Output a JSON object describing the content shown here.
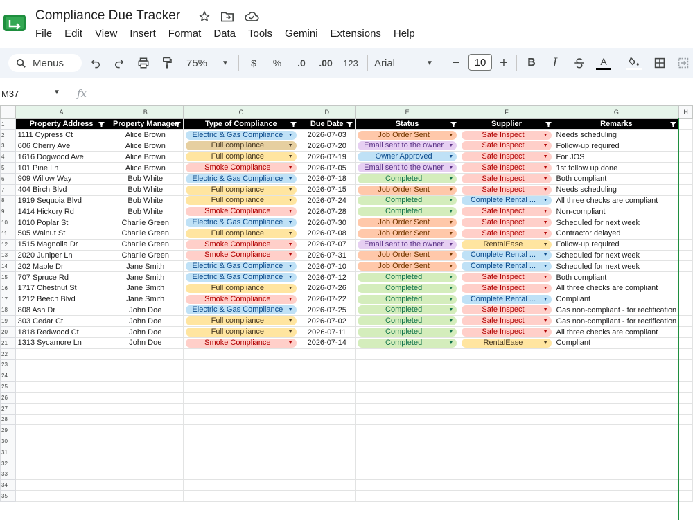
{
  "app": {
    "title": "Compliance Due Tracker",
    "menus": [
      "File",
      "Edit",
      "View",
      "Insert",
      "Format",
      "Data",
      "Tools",
      "Gemini",
      "Extensions",
      "Help"
    ]
  },
  "toolbar": {
    "search_label": "Menus",
    "zoom": "75%",
    "currency": "$",
    "percent": "%",
    "decrease_decimal": ".0",
    "increase_decimal": ".00",
    "number_format": "123",
    "font": "Arial",
    "font_size": "10",
    "bold": "B",
    "italic": "I",
    "text_color_letter": "A"
  },
  "formula_bar": {
    "cell_ref": "M37",
    "fx": "fx"
  },
  "sheet": {
    "columns": [
      "A",
      "B",
      "C",
      "D",
      "E",
      "F",
      "G",
      "H"
    ],
    "headers": [
      "Property Address",
      "Property Manager",
      "Type of Compliance",
      "Due Date",
      "Status",
      "Supplier",
      "Remarks"
    ],
    "rows": [
      [
        "1111 Cypress Ct",
        "Alice Brown",
        "Electric & Gas Compliance",
        "2026-07-03",
        "Job Order Sent",
        "Safe Inspect",
        "Needs scheduling"
      ],
      [
        "606 Cherry Ave",
        "Alice Brown",
        "Full compliance",
        "2026-07-20",
        "Email sent to the owner",
        "Safe Inspect",
        "Follow-up required"
      ],
      [
        "1616 Dogwood Ave",
        "Alice Brown",
        "Full compliance",
        "2026-07-19",
        "Owner Approved",
        "Safe Inspect",
        "For JOS"
      ],
      [
        "101 Pine Ln",
        "Alice Brown",
        "Smoke Compliance",
        "2026-07-05",
        "Email sent to the owner",
        "Safe Inspect",
        "1st follow up done"
      ],
      [
        "909 Willow Way",
        "Bob White",
        "Electric & Gas Compliance",
        "2026-07-18",
        "Completed",
        "Safe Inspect",
        "Both compliant"
      ],
      [
        "404 Birch Blvd",
        "Bob White",
        "Full compliance",
        "2026-07-15",
        "Job Order Sent",
        "Safe Inspect",
        "Needs scheduling"
      ],
      [
        "1919 Sequoia Blvd",
        "Bob White",
        "Full compliance",
        "2026-07-24",
        "Completed",
        "Complete Rental ...",
        "All three checks are compliant"
      ],
      [
        "1414 Hickory Rd",
        "Bob White",
        "Smoke Compliance",
        "2026-07-28",
        "Completed",
        "Safe Inspect",
        "Non-compliant"
      ],
      [
        "1010 Poplar St",
        "Charlie Green",
        "Electric & Gas Compliance",
        "2026-07-30",
        "Job Order Sent",
        "Safe Inspect",
        "Scheduled for next week"
      ],
      [
        "505 Walnut St",
        "Charlie Green",
        "Full compliance",
        "2026-07-08",
        "Job Order Sent",
        "Safe Inspect",
        "Contractor delayed"
      ],
      [
        "1515 Magnolia Dr",
        "Charlie Green",
        "Smoke Compliance",
        "2026-07-07",
        "Email sent to the owner",
        "RentalEase",
        "Follow-up required"
      ],
      [
        "2020 Juniper Ln",
        "Charlie Green",
        "Smoke Compliance",
        "2026-07-31",
        "Job Order Sent",
        "Complete Rental ...",
        "Scheduled for next week"
      ],
      [
        "202 Maple Dr",
        "Jane Smith",
        "Electric & Gas Compliance",
        "2026-07-10",
        "Job Order Sent",
        "Complete Rental ...",
        "Scheduled for next week"
      ],
      [
        "707 Spruce Rd",
        "Jane Smith",
        "Electric & Gas Compliance",
        "2026-07-12",
        "Completed",
        "Safe Inspect",
        "Both compliant"
      ],
      [
        "1717 Chestnut St",
        "Jane Smith",
        "Full compliance",
        "2026-07-26",
        "Completed",
        "Safe Inspect",
        "All three checks are compliant"
      ],
      [
        "1212 Beech Blvd",
        "Jane Smith",
        "Smoke Compliance",
        "2026-07-22",
        "Completed",
        "Complete Rental ...",
        "Compliant"
      ],
      [
        "808 Ash Dr",
        "John Doe",
        "Electric & Gas Compliance",
        "2026-07-25",
        "Completed",
        "Safe Inspect",
        "Gas non-compliant - for rectification"
      ],
      [
        "303 Cedar Ct",
        "John Doe",
        "Full compliance",
        "2026-07-02",
        "Completed",
        "Safe Inspect",
        "Gas non-compliant - for rectification"
      ],
      [
        "1818 Redwood Ct",
        "John Doe",
        "Full compliance",
        "2026-07-11",
        "Completed",
        "Safe Inspect",
        "All three checks are compliant"
      ],
      [
        "1313 Sycamore Ln",
        "John Doe",
        "Smoke Compliance",
        "2026-07-14",
        "Completed",
        "RentalEase",
        "Compliant"
      ]
    ],
    "empty_row_numbers": [
      22,
      23,
      24,
      25,
      26,
      27,
      28,
      29,
      30,
      31,
      32,
      33,
      34,
      35
    ],
    "chip_colors": {
      "Electric & Gas Compliance": "#bfe1f6",
      "Full compliance": "#ffe5a0",
      "Smoke Compliance": "#ffcfc9",
      "Job Order Sent": "#ffc8aa",
      "Email sent to the owner": "#e6cff2",
      "Owner Approved": "#bfe1f6",
      "Completed": "#d4edbc",
      "Safe Inspect": "#ffcfc9",
      "Complete Rental ...": "#bfe1f6",
      "RentalEase": "#ffe5a0"
    }
  }
}
